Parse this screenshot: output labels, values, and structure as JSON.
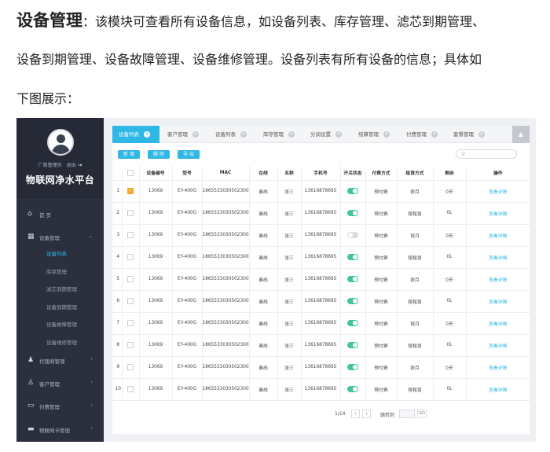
{
  "doc": {
    "heading": "设备管理",
    "line1_rest": "：该模块可查看所有设备信息，如设备列表、库存管理、滤芯到期管理、",
    "line2": "设备到期管理、设备故障管理、设备维修管理。设备列表有所有设备的信息；具体如",
    "line3": "下图展示："
  },
  "sidebar": {
    "admin_label": "厂商管理员",
    "logout_label": "退出",
    "brand": "物联网净水平台",
    "home": "首 页",
    "device_mgmt": "设备管理",
    "sub_items": [
      "设备列表",
      "库存管理",
      "滤芯到期管理",
      "设备到期管理",
      "设备故障管理",
      "设备维修管理"
    ],
    "agent_mgmt": "代理商管理",
    "customer_mgmt": "客户管理",
    "billing_mgmt": "付费管理",
    "iot_card_mgmt": "物联网卡管理"
  },
  "tabs": [
    "设备列表",
    "客户管理",
    "设备列表",
    "库存管理",
    "分润设置",
    "结算管理",
    "付费管理",
    "套餐管理"
  ],
  "toolbar": {
    "add": "新 增",
    "delete": "删 除",
    "export": "导 出"
  },
  "table": {
    "headers": [
      "设备编号",
      "型号",
      "MAC",
      "在线",
      "名称",
      "手机号",
      "开关状态",
      "付费方式",
      "租赁方式",
      "剩余",
      "操作"
    ],
    "rows": [
      {
        "no": "1",
        "checked": true,
        "id": "13069",
        "model": "EY-400G",
        "mac": "1865533030502300",
        "online": "离线",
        "name": "张三",
        "phone": "13616878695",
        "on": true,
        "pay": "预付费",
        "lease": "按月",
        "remain": "0天",
        "action": "查看详情"
      },
      {
        "no": "2",
        "checked": false,
        "id": "13069",
        "model": "EY-400G",
        "mac": "1865533030502300",
        "online": "离线",
        "name": "张三",
        "phone": "13616878695",
        "on": true,
        "pay": "预付费",
        "lease": "按租赁",
        "remain": "0L",
        "action": "查看详情"
      },
      {
        "no": "3",
        "checked": false,
        "id": "13069",
        "model": "EY-400G",
        "mac": "1865533030502300",
        "online": "离线",
        "name": "张三",
        "phone": "13616878695",
        "on": false,
        "pay": "预付费",
        "lease": "按月",
        "remain": "0天",
        "action": "查看详情"
      },
      {
        "no": "4",
        "checked": false,
        "id": "13069",
        "model": "EY-400G",
        "mac": "1865533030502300",
        "online": "离线",
        "name": "张三",
        "phone": "13616878695",
        "on": true,
        "pay": "预付费",
        "lease": "按租赁",
        "remain": "0L",
        "action": "查看详情"
      },
      {
        "no": "5",
        "checked": false,
        "id": "13069",
        "model": "EY-400G",
        "mac": "1865533030502300",
        "online": "离线",
        "name": "张三",
        "phone": "13616878695",
        "on": true,
        "pay": "预付费",
        "lease": "按月",
        "remain": "0天",
        "action": "查看详情"
      },
      {
        "no": "6",
        "checked": false,
        "id": "13069",
        "model": "EY-400G",
        "mac": "1865533030502300",
        "online": "离线",
        "name": "张三",
        "phone": "13616878695",
        "on": true,
        "pay": "预付费",
        "lease": "按租赁",
        "remain": "0L",
        "action": "查看详情"
      },
      {
        "no": "7",
        "checked": false,
        "id": "13069",
        "model": "EY-400G",
        "mac": "1865533030502300",
        "online": "离线",
        "name": "张三",
        "phone": "13616878695",
        "on": true,
        "pay": "预付费",
        "lease": "按月",
        "remain": "0天",
        "action": "查看详情"
      },
      {
        "no": "8",
        "checked": false,
        "id": "13069",
        "model": "EY-400G",
        "mac": "1865533030502300",
        "online": "离线",
        "name": "张三",
        "phone": "13616878695",
        "on": true,
        "pay": "预付费",
        "lease": "按租赁",
        "remain": "0L",
        "action": "查看详情"
      },
      {
        "no": "9",
        "checked": false,
        "id": "13069",
        "model": "EY-400G",
        "mac": "1865533030502300",
        "online": "离线",
        "name": "张三",
        "phone": "13616878695",
        "on": true,
        "pay": "预付费",
        "lease": "按月",
        "remain": "0天",
        "action": "查看详情"
      },
      {
        "no": "10",
        "checked": false,
        "id": "13069",
        "model": "EY-400G",
        "mac": "1865533030502300",
        "online": "离线",
        "name": "张三",
        "phone": "13616878695",
        "on": true,
        "pay": "预付费",
        "lease": "按租赁",
        "remain": "0L",
        "action": "查看详情"
      }
    ]
  },
  "pager": {
    "page": "1/14",
    "jump_label": "跳转到",
    "go": "GO"
  },
  "colors": {
    "accent": "#2fb7e6",
    "sidebar": "#2b2f3e",
    "toggle_on": "#3fc59a",
    "checkbox": "#f5a623"
  }
}
